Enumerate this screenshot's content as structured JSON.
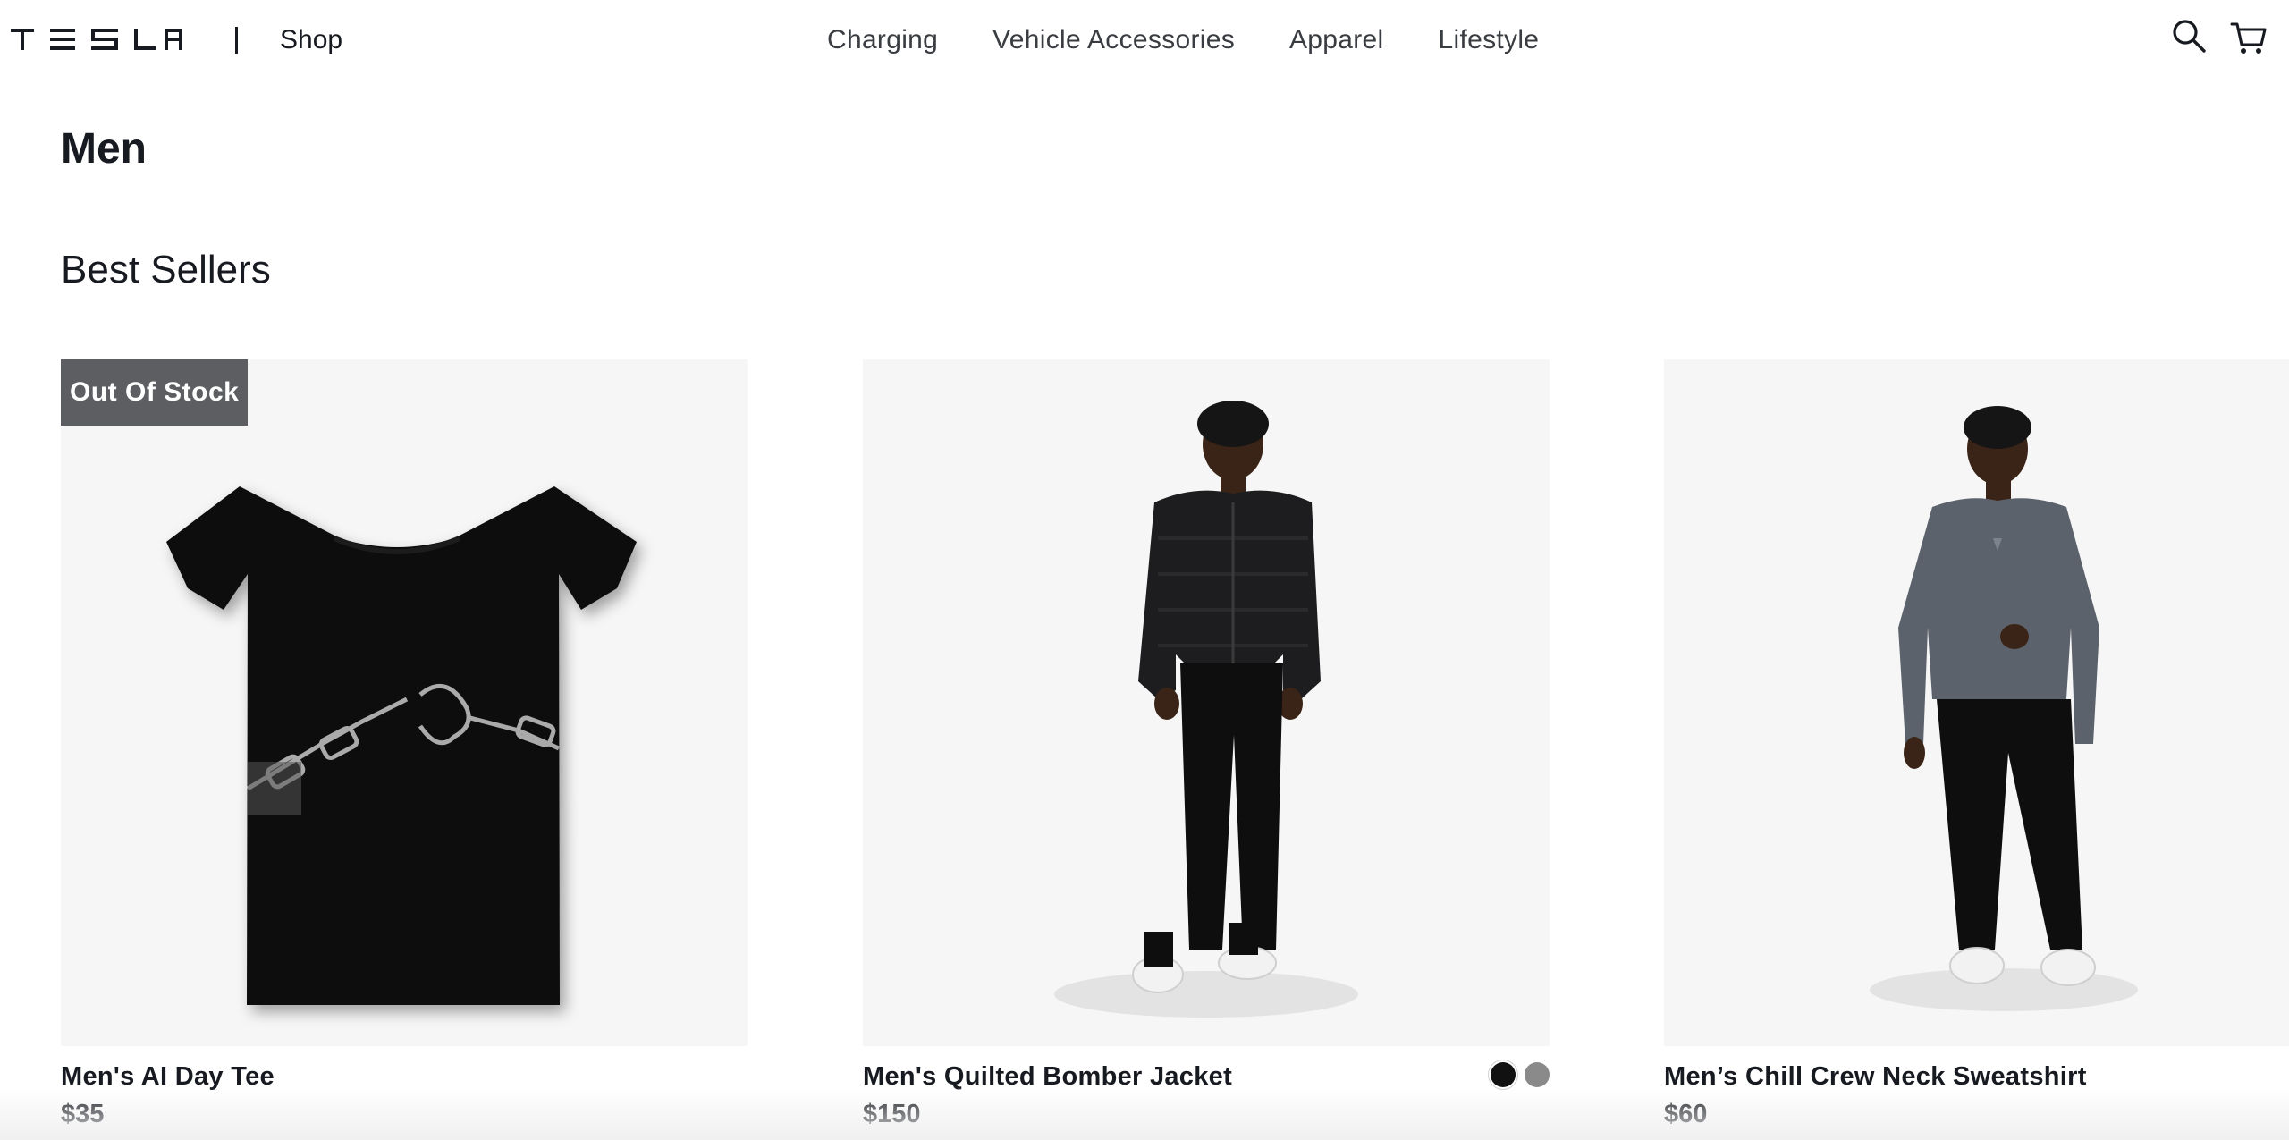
{
  "header": {
    "logo_text": "TESLA",
    "shop_label": "Shop",
    "nav": [
      "Charging",
      "Vehicle Accessories",
      "Apparel",
      "Lifestyle"
    ],
    "search_icon": "search-icon",
    "cart_icon": "cart-icon"
  },
  "page": {
    "title": "Men",
    "section_title": "Best Sellers"
  },
  "products": [
    {
      "name": "Men's AI Day Tee",
      "price": "$35",
      "badge": "Out Of Stock",
      "image": "black-tshirt-with-chain-heart-graphic"
    },
    {
      "name": "Men's Quilted Bomber Jacket",
      "price": "$150",
      "image": "model-in-black-quilted-bomber-jacket",
      "swatches": [
        {
          "color": "#111111",
          "selected": true
        },
        {
          "color": "#8a8a8a",
          "selected": false
        }
      ]
    },
    {
      "name": "Men’s Chill Crew Neck Sweatshirt",
      "price": "$60",
      "image": "model-in-grey-crew-neck-sweatshirt"
    }
  ],
  "colors": {
    "text": "#171a20",
    "nav_text": "#393c41",
    "badge_bg": "#5c5e62",
    "image_bg": "#f6f6f6"
  }
}
